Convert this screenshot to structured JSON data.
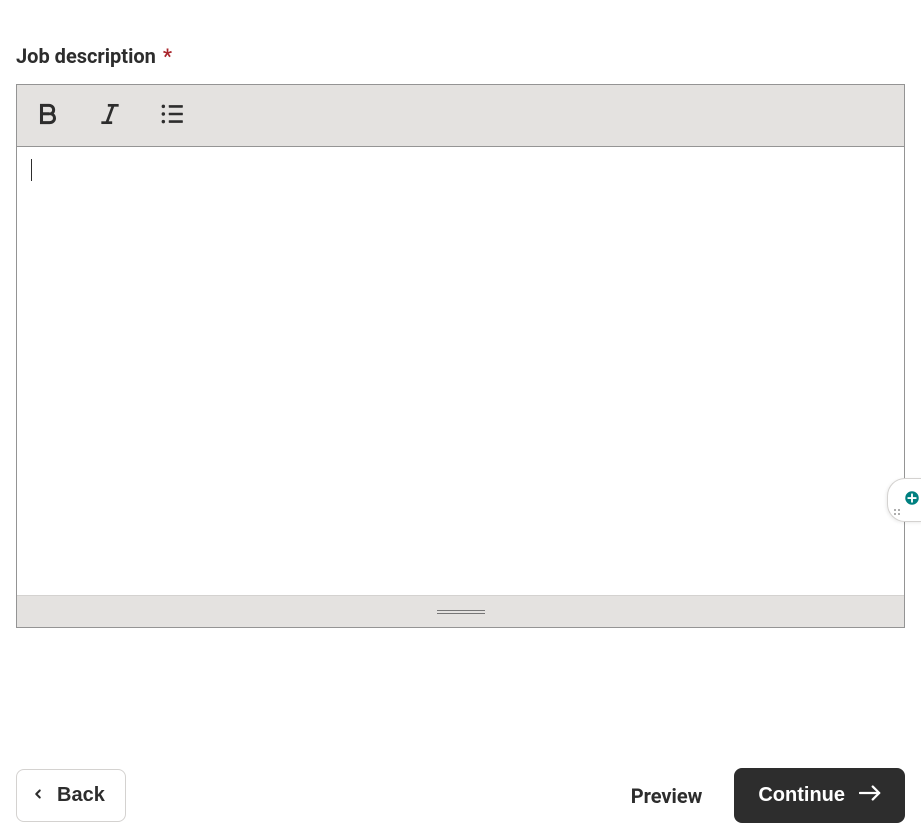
{
  "field": {
    "label": "Job description",
    "required_mark": "*"
  },
  "editor": {
    "content": ""
  },
  "actions": {
    "back_label": "Back",
    "preview_label": "Preview",
    "continue_label": "Continue"
  }
}
